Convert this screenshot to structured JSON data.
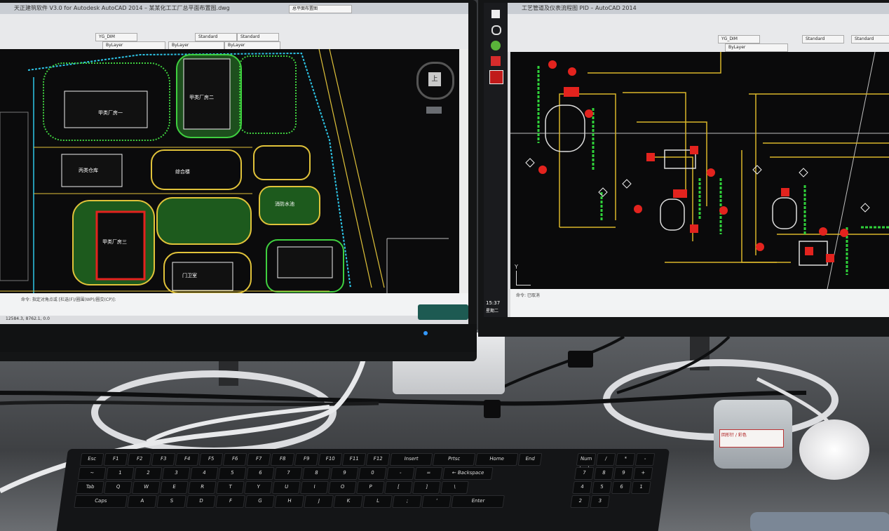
{
  "left_monitor": {
    "title": "天正建筑软件 V3.0 for Autodesk AutoCAD 2014 – 某某化工工厂总平面布置图.dwg",
    "file_tab": "总平面布置图",
    "ribbon_items": [
      "YG_DIM",
      "Standard",
      "Standard",
      "ByLayer",
      "ByLayer",
      "ByLayer"
    ],
    "viewcube_face": "上",
    "buildings": [
      "甲类厂房一",
      "甲类厂房二",
      "丙类仓库",
      "甲类厂房三",
      "综合楼",
      "消防水池",
      "门卫室"
    ],
    "cmd_text": "命令: 指定对角点或 [栏选(F)/圈围(WP)/圈交(CP)]:",
    "coords": "12584.3, 8762.1, 0.0"
  },
  "right_monitor": {
    "title": "工艺管道及仪表流程图 PID – AutoCAD 2014",
    "ribbon_items": [
      "YG_DIM",
      "Standard",
      "Standard",
      "ByLayer"
    ],
    "axis_label": "Y",
    "clock": "15:37",
    "date": "星期二",
    "cmd_text": "命令: 已取消"
  },
  "desk": {
    "jar_label": "回形针 / 彩色",
    "keyboard_keys_row1": [
      "Esc",
      "F1",
      "F2",
      "F3",
      "F4",
      "F5",
      "F6",
      "F7",
      "F8",
      "F9",
      "F10",
      "F11",
      "F12",
      "Insert",
      "Prtsc",
      "Home",
      "End"
    ],
    "keyboard_keys_row2": [
      "~",
      "1",
      "2",
      "3",
      "4",
      "5",
      "6",
      "7",
      "8",
      "9",
      "0",
      "-",
      "=",
      "← Backspace"
    ],
    "keyboard_keys_row3": [
      "Tab",
      "Q",
      "W",
      "E",
      "R",
      "T",
      "Y",
      "U",
      "I",
      "O",
      "P",
      "[",
      "]",
      "\\"
    ],
    "keyboard_keys_row4": [
      "Caps",
      "A",
      "S",
      "D",
      "F",
      "G",
      "H",
      "J",
      "K",
      "L",
      ";",
      "'",
      "Enter"
    ],
    "numpad": [
      "Num Lock",
      "/",
      "*",
      "-",
      "7",
      "8",
      "9",
      "+",
      "4",
      "5",
      "6",
      "1",
      "2",
      "3"
    ]
  },
  "colors": {
    "cad_background": "#0b0b0c",
    "site_green": "#3fcf3f",
    "site_yellow": "#e0c23a",
    "site_cyan": "#2ec6e8",
    "pid_yellow": "#d9b62a",
    "pid_red": "#e3231e",
    "pid_green": "#2fd13a"
  }
}
